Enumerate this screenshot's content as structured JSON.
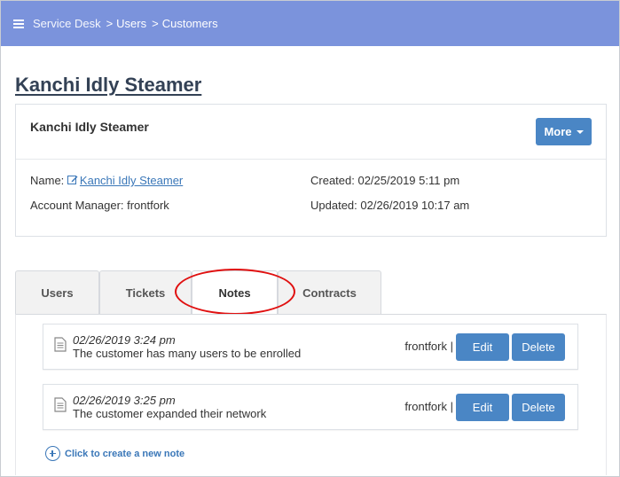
{
  "breadcrumb": {
    "items": [
      "Service Desk",
      "Users",
      "Customers"
    ],
    "separator": ">"
  },
  "page_title": "Kanchi Idly Steamer",
  "card": {
    "title": "Kanchi Idly Steamer",
    "more_label": "More",
    "name_label": "Name:",
    "name_value": "Kanchi Idly Steamer",
    "account_manager": "Account Manager: frontfork",
    "created": "Created: 02/25/2019 5:11 pm",
    "updated": "Updated: 02/26/2019 10:17 am"
  },
  "tabs": [
    {
      "label": "Users",
      "active": false
    },
    {
      "label": "Tickets",
      "active": false
    },
    {
      "label": "Notes",
      "active": true
    },
    {
      "label": "Contracts",
      "active": false
    }
  ],
  "notes": [
    {
      "date": "02/26/2019 3:24 pm",
      "text": "The customer has many users to be enrolled",
      "author": "frontfork |",
      "edit_label": "Edit",
      "delete_label": "Delete"
    },
    {
      "date": "02/26/2019 3:25 pm",
      "text": "The customer expanded their network",
      "author": "frontfork |",
      "edit_label": "Edit",
      "delete_label": "Delete"
    }
  ],
  "new_note_label": "Click to create a new note",
  "colors": {
    "topbar": "#7b93dc",
    "button": "#4a86c5",
    "link": "#3a77b8",
    "highlight": "#e01010"
  },
  "icons": {
    "menu": "hamburger-icon",
    "edit": "edit-icon",
    "note": "document-icon",
    "add": "plus-circle-icon",
    "dropdown": "caret-down-icon"
  }
}
